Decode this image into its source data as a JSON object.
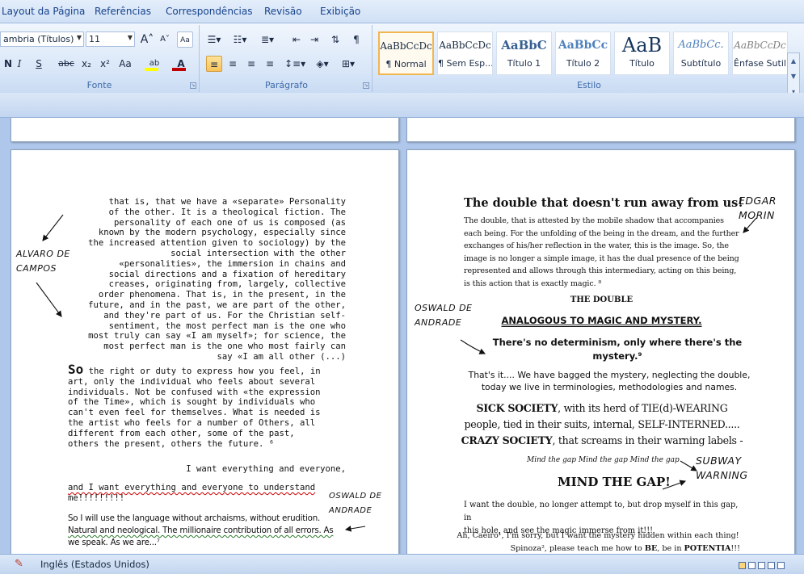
{
  "tabs": [
    "Layout da Página",
    "Referências",
    "Correspondências",
    "Revisão",
    "Exibição"
  ],
  "ribbon": {
    "font_group_label": "Fonte",
    "paragraph_group_label": "Parágrafo",
    "style_group_label": "Estilo",
    "font_name": "ambria (Títulos)",
    "font_size": "11",
    "grow_label": "A",
    "shrink_label": "A",
    "clear_label": "Aa",
    "font_buttons": [
      "N",
      "I",
      "S",
      "abc",
      "x₂",
      "x²",
      "Aa"
    ],
    "highlight_label": "ab",
    "fontcolor_label": "A",
    "highlight_color": "#ffff00",
    "fontcolor_color": "#c00000",
    "styles": [
      {
        "sample": "AaBbCcDc",
        "name": "¶ Normal"
      },
      {
        "sample": "AaBbCcDc",
        "name": "¶ Sem Esp..."
      },
      {
        "sample": "AaBbC",
        "name": "Título 1"
      },
      {
        "sample": "AaBbCc",
        "name": "Título 2"
      },
      {
        "sample": "AaB",
        "name": "Título"
      },
      {
        "sample": "AaBbCc.",
        "name": "Subtítulo"
      },
      {
        "sample": "AaBbCcDc",
        "name": "Ênfase Sutil"
      }
    ]
  },
  "left_page": {
    "quote_lines": [
      "that is, that we have a «separate» Personality",
      "of the other. It is a theological fiction. The",
      "personality of each one of us is composed (as",
      "known by the modern psychology, especially since",
      "the increased attention given to sociology) by the",
      "social intersection with the other",
      "«personalities», the immersion in chains and",
      "social directions and a fixation of hereditary",
      "creases, originating from, largely, collective",
      "order phenomena. That is, in the present, in the",
      "future, and in the past, we are part of the other,",
      "and they're part of us. For the Christian self-",
      "sentiment, the most perfect man is the one who",
      "most truly can say «I am myself»; for science, the",
      "most perfect man is the one who most fairly can",
      "say «I am all other (...)"
    ],
    "so_word": "So",
    "so_lines": [
      " the right or duty to express how you feel, in",
      "art, only the individual who feels about several",
      "individuals. Not be confused with «the expression",
      "of the Time», which is sought by individuals who",
      "can't even feel for themselves. What is needed is",
      "the artist who feels for a number of Others, all",
      "different from each other, some of the past,",
      "others the present, others the future. ⁶"
    ],
    "want_line": "I want everything and everyone,",
    "and_lines": [
      "and I want everything and everyone to understand",
      "me!!!!!!!!!"
    ],
    "last_lines": [
      "So I will use the language without archaisms, without erudition.",
      "Natural and neological. The millionaire contribution of all errors. As",
      "we speak. As we are...⁷"
    ],
    "annot_alvaro": "ALVARO DE\nCAMPOS",
    "annot_oswald": "OSWALD DE\nANDRADE"
  },
  "right_page": {
    "title": "The double that doesn't run away from us!",
    "para1": [
      "The double, that is attested by the mobile shadow that accompanies",
      "each being. For the unfolding of the being in the dream, and the further",
      "exchanges of his/her reflection in the water, this is the image. So, the",
      "image is no longer a simple image, it has the dual presence of the being",
      "represented and allows through this intermediary, acting on this being,",
      "is this action that is exactly magic. ⁸"
    ],
    "the_double": "THE DOUBLE",
    "analogous": "ANALOGOUS TO MAGIC AND MYSTERY.",
    "determinism": [
      "There's no determinism, only where there's the",
      "mystery.⁹"
    ],
    "thats_it": [
      "That's it.... We have bagged the mystery, neglecting the double,",
      "today we live in terminologies, methodologies and names."
    ],
    "sick_lines": [
      {
        "bold": "SICK SOCIETY",
        "rest": ", with its herd of TIE(d)-WEARING"
      },
      {
        "bold": "",
        "rest": "people, tied in their suits, internal, SELF-INTERNED....."
      },
      {
        "bold": "CRAZY SOCIETY",
        "rest": ", that screams in their warning labels -"
      }
    ],
    "mind_small": "Mind the gap Mind the gap Mind the gap",
    "mind_big": "MIND THE GAP!",
    "want_double": [
      "I want the double, no longer attempt to, but drop myself in this gap, in",
      "this hole, and see the magic immerse from it!!!"
    ],
    "caeiro": "Ah, Caeiro¹, I'm sorry, but I want the mystery hidden within each thing!",
    "spinoza_a": "Spinoza², please teach me how to ",
    "spinoza_be": "BE",
    "spinoza_b": ", be in ",
    "spinoza_pot": "POTENTIA",
    "spinoza_c": "!!!",
    "annot_edgar": "EDGAR\nMORIN",
    "annot_oswald": "OSWALD DE\nANDRADE",
    "annot_subway": "SUBWAY\nWARNING"
  },
  "status": {
    "language": "Inglês (Estados Unidos)"
  }
}
